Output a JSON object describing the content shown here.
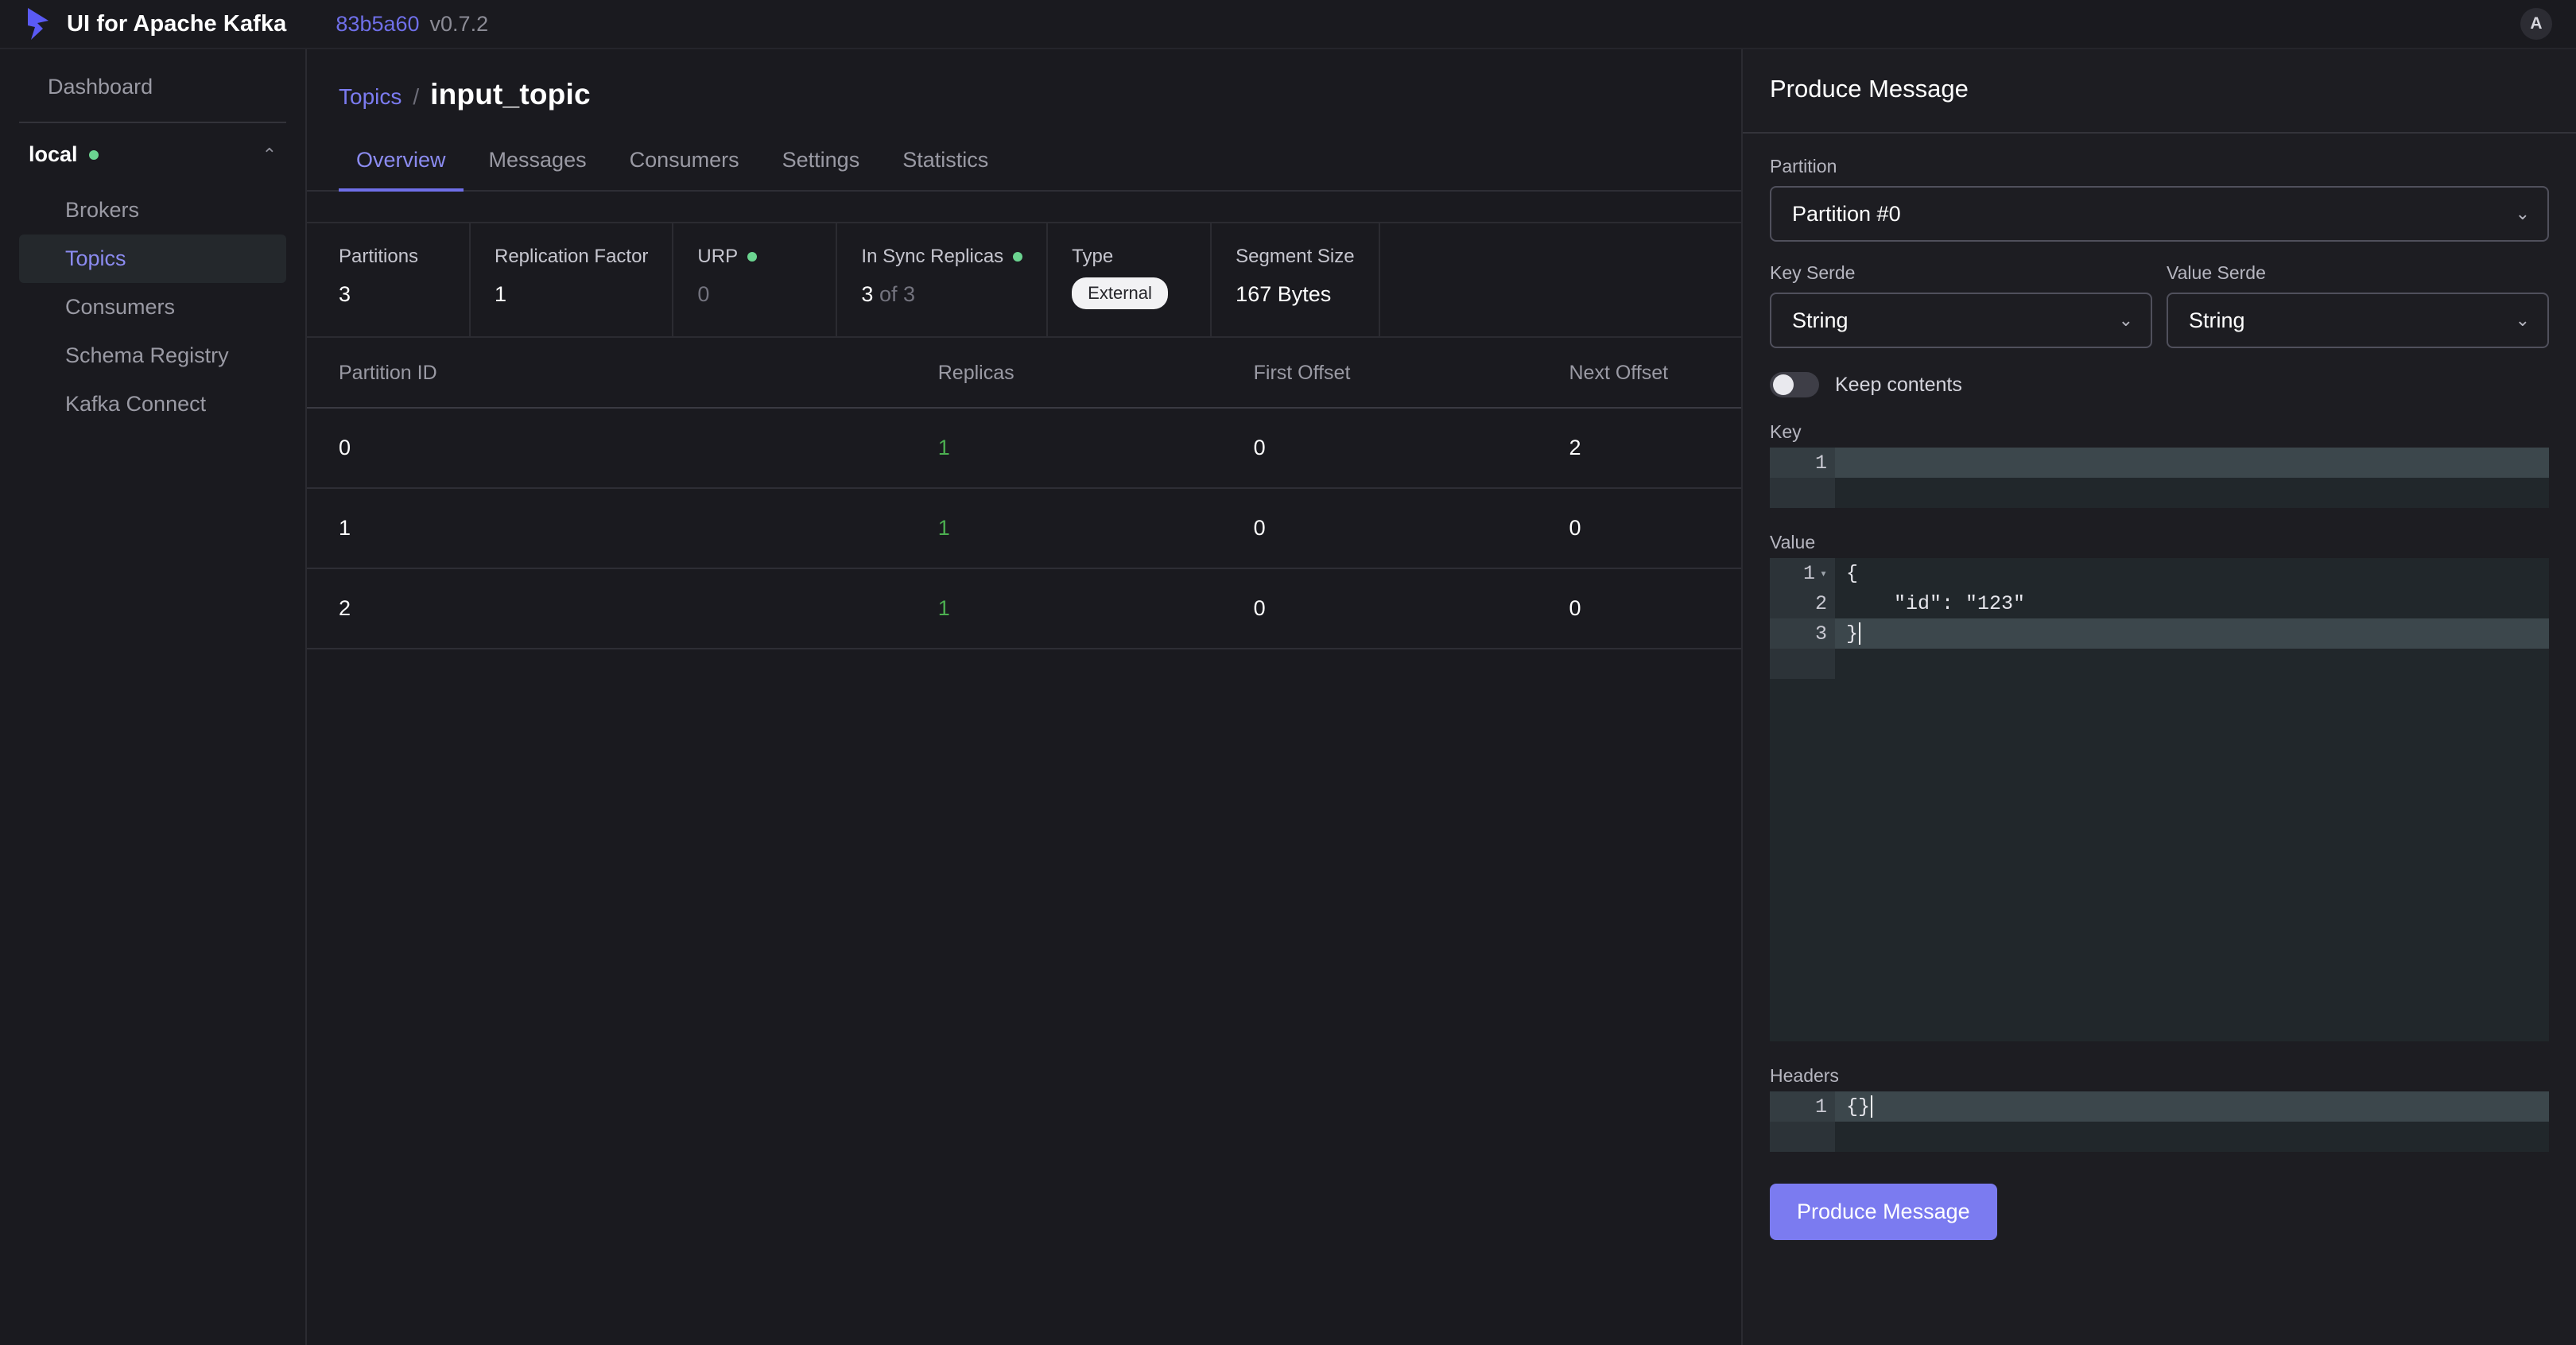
{
  "topbar": {
    "brand": "UI for Apache Kafka",
    "commit": "83b5a60",
    "version": "v0.7.2",
    "avatar_initial": "A"
  },
  "sidebar": {
    "dashboard_label": "Dashboard",
    "cluster_name": "local",
    "items": [
      {
        "label": "Brokers"
      },
      {
        "label": "Topics"
      },
      {
        "label": "Consumers"
      },
      {
        "label": "Schema Registry"
      },
      {
        "label": "Kafka Connect"
      }
    ]
  },
  "main": {
    "breadcrumb": {
      "parent": "Topics",
      "separator": "/",
      "current": "input_topic"
    },
    "tabs": [
      {
        "label": "Overview"
      },
      {
        "label": "Messages"
      },
      {
        "label": "Consumers"
      },
      {
        "label": "Settings"
      },
      {
        "label": "Statistics"
      }
    ],
    "metrics": [
      {
        "label": "Partitions",
        "value": "3"
      },
      {
        "label": "Replication Factor",
        "value": "1"
      },
      {
        "label": "URP",
        "value": "0"
      },
      {
        "label": "In Sync Replicas",
        "value": "3",
        "suffix": " of 3"
      },
      {
        "label": "Type",
        "badge": "External"
      },
      {
        "label": "Segment Size",
        "value": "167 Bytes"
      }
    ],
    "table": {
      "headers": [
        "Partition ID",
        "Replicas",
        "First Offset",
        "Next Offset"
      ],
      "rows": [
        {
          "partition_id": "0",
          "replicas": "1",
          "first_offset": "0",
          "next_offset": "2"
        },
        {
          "partition_id": "1",
          "replicas": "1",
          "first_offset": "0",
          "next_offset": "0"
        },
        {
          "partition_id": "2",
          "replicas": "1",
          "first_offset": "0",
          "next_offset": "0"
        }
      ]
    }
  },
  "panel": {
    "title": "Produce Message",
    "partition_label": "Partition",
    "partition_value": "Partition #0",
    "key_serde_label": "Key Serde",
    "key_serde_value": "String",
    "value_serde_label": "Value Serde",
    "value_serde_value": "String",
    "keep_contents_label": "Keep contents",
    "key_label": "Key",
    "key_lines": [
      {
        "num": "1",
        "text": ""
      }
    ],
    "value_label": "Value",
    "value_lines": [
      {
        "num": "1",
        "text": "{"
      },
      {
        "num": "2",
        "text": "    \"id\": \"123\""
      },
      {
        "num": "3",
        "text": "}"
      }
    ],
    "headers_label": "Headers",
    "headers_lines": [
      {
        "num": "1",
        "text": "{}"
      }
    ],
    "produce_button": "Produce Message"
  },
  "colors": {
    "accent": "#7b7bf0",
    "link": "#7b7bf0",
    "status_green": "#6bd490",
    "replica_green": "#4caf50",
    "json_string": "#4caf50",
    "app_bg": "#1a1a1f",
    "panel_bg": "#1d1d22",
    "editor_bg": "#21272b"
  },
  "icons": {
    "chevron_down": "⌄",
    "chevron_up": "⌃",
    "fold_down": "▾"
  }
}
